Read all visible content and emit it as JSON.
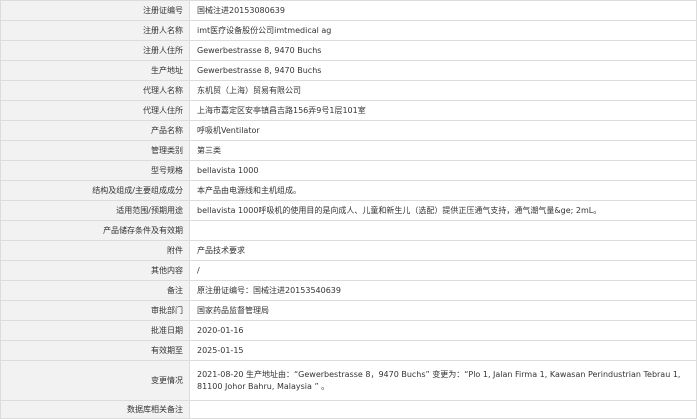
{
  "rows": [
    {
      "label": "注册证编号",
      "value": "国械注进20153080639"
    },
    {
      "label": "注册人名称",
      "value": "imt医疗设备股份公司imtmedical ag"
    },
    {
      "label": "注册人住所",
      "value": "Gewerbestrasse 8, 9470 Buchs"
    },
    {
      "label": "生产地址",
      "value": "Gewerbestrasse 8, 9470 Buchs"
    },
    {
      "label": "代理人名称",
      "value": "东机贸（上海）贸易有限公司"
    },
    {
      "label": "代理人住所",
      "value": "上海市嘉定区安亭镇昌吉路156弄9号1层101室"
    },
    {
      "label": "产品名称",
      "value": "呼吸机Ventilator"
    },
    {
      "label": "管理类别",
      "value": "第三类"
    },
    {
      "label": "型号规格",
      "value": "bellavista 1000"
    },
    {
      "label": "结构及组成/主要组成成分",
      "value": "本产品由电源线和主机组成。"
    },
    {
      "label": "适用范围/预期用途",
      "value": "bellavista 1000呼吸机的使用目的是向成人、儿童和新生儿（选配）提供正压通气支持，通气潮气量&ge; 2mL。"
    },
    {
      "label": "产品储存条件及有效期",
      "value": ""
    },
    {
      "label": "附件",
      "value": "产品技术要求"
    },
    {
      "label": "其他内容",
      "value": "/"
    },
    {
      "label": "备注",
      "value": "原注册证编号：国械注进20153540639"
    },
    {
      "label": "审批部门",
      "value": "国家药品监督管理局"
    },
    {
      "label": "批准日期",
      "value": "2020-01-16"
    },
    {
      "label": "有效期至",
      "value": "2025-01-15"
    },
    {
      "label": "变更情况",
      "value": "2021-08-20 生产地址由：“Gewerbestrasse 8，9470 Buchs” 变更为：“Plo 1, Jalan Firma 1, Kawasan Perindustrian Tebrau 1, 81100 Johor Bahru, Malaysia ” 。"
    },
    {
      "label": "数据库相关备注",
      "value": ""
    }
  ]
}
